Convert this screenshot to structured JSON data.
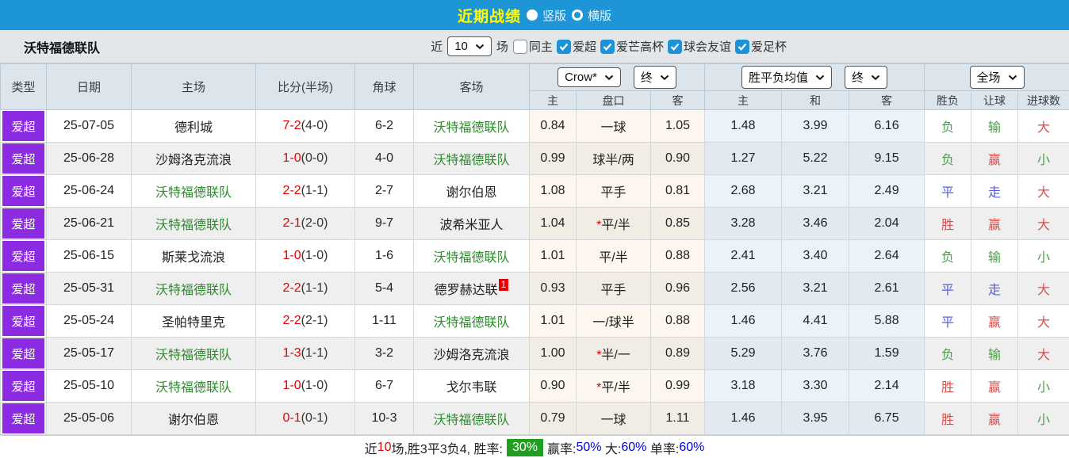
{
  "topbar": {
    "title": "近期战绩",
    "radios": [
      {
        "label": "竖版",
        "selected": true
      },
      {
        "label": "横版",
        "selected": false
      }
    ]
  },
  "filterbar": {
    "team": "沃特福德联队",
    "near": "近",
    "count": "10",
    "games": "场",
    "filters": [
      {
        "label": "同主",
        "checked": false
      },
      {
        "label": "爱超",
        "checked": true
      },
      {
        "label": "爱芒高杯",
        "checked": true
      },
      {
        "label": "球会友谊",
        "checked": true
      },
      {
        "label": "爱足杯",
        "checked": true
      }
    ]
  },
  "table": {
    "main_headers": [
      "类型",
      "日期",
      "主场",
      "比分(半场)",
      "角球",
      "客场"
    ],
    "selects": {
      "odds_company": "Crow*",
      "odds_state": "终",
      "avg_label": "胜平负均值",
      "avg_state": "终",
      "scope": "全场"
    },
    "sub_headers": [
      "主",
      "盘口",
      "客",
      "主",
      "和",
      "客",
      "胜负",
      "让球",
      "进球数"
    ],
    "rows": [
      {
        "type": "爱超",
        "date": "25-07-05",
        "home": "德利城",
        "home_class": "",
        "score": "7-2",
        "half": "(4-0)",
        "corner": "6-2",
        "away": "沃特福德联队",
        "away_class": "green",
        "away_badge": "",
        "odds_home": "0.84",
        "handicap_star": "",
        "handicap": "一球",
        "odds_away": "1.05",
        "avg_home": "1.48",
        "avg_draw": "3.99",
        "avg_away": "6.16",
        "res_wdl": "负",
        "res_wdl_class": "green",
        "res_ah": "输",
        "res_ah_class": "green",
        "res_ou": "大",
        "res_ou_class": "red"
      },
      {
        "type": "爱超",
        "date": "25-06-28",
        "home": "沙姆洛克流浪",
        "home_class": "",
        "score": "1-0",
        "half": "(0-0)",
        "corner": "4-0",
        "away": "沃特福德联队",
        "away_class": "green",
        "away_badge": "",
        "odds_home": "0.99",
        "handicap_star": "",
        "handicap": "球半/两",
        "odds_away": "0.90",
        "avg_home": "1.27",
        "avg_draw": "5.22",
        "avg_away": "9.15",
        "res_wdl": "负",
        "res_wdl_class": "green",
        "res_ah": "赢",
        "res_ah_class": "red",
        "res_ou": "小",
        "res_ou_class": "green"
      },
      {
        "type": "爱超",
        "date": "25-06-24",
        "home": "沃特福德联队",
        "home_class": "green",
        "score": "2-2",
        "half": "(1-1)",
        "corner": "2-7",
        "away": "谢尔伯恩",
        "away_class": "",
        "away_badge": "",
        "odds_home": "1.08",
        "handicap_star": "",
        "handicap": "平手",
        "odds_away": "0.81",
        "avg_home": "2.68",
        "avg_draw": "3.21",
        "avg_away": "2.49",
        "res_wdl": "平",
        "res_wdl_class": "blue",
        "res_ah": "走",
        "res_ah_class": "blue",
        "res_ou": "大",
        "res_ou_class": "red"
      },
      {
        "type": "爱超",
        "date": "25-06-21",
        "home": "沃特福德联队",
        "home_class": "green",
        "score": "2-1",
        "half": "(2-0)",
        "corner": "9-7",
        "away": "波希米亚人",
        "away_class": "",
        "away_badge": "",
        "odds_home": "1.04",
        "handicap_star": "*",
        "handicap": "平/半",
        "odds_away": "0.85",
        "avg_home": "3.28",
        "avg_draw": "3.46",
        "avg_away": "2.04",
        "res_wdl": "胜",
        "res_wdl_class": "red",
        "res_ah": "赢",
        "res_ah_class": "red",
        "res_ou": "大",
        "res_ou_class": "red"
      },
      {
        "type": "爱超",
        "date": "25-06-15",
        "home": "斯莱戈流浪",
        "home_class": "",
        "score": "1-0",
        "half": "(1-0)",
        "corner": "1-6",
        "away": "沃特福德联队",
        "away_class": "green",
        "away_badge": "",
        "odds_home": "1.01",
        "handicap_star": "",
        "handicap": "平/半",
        "odds_away": "0.88",
        "avg_home": "2.41",
        "avg_draw": "3.40",
        "avg_away": "2.64",
        "res_wdl": "负",
        "res_wdl_class": "green",
        "res_ah": "输",
        "res_ah_class": "green",
        "res_ou": "小",
        "res_ou_class": "green"
      },
      {
        "type": "爱超",
        "date": "25-05-31",
        "home": "沃特福德联队",
        "home_class": "green",
        "score": "2-2",
        "half": "(1-1)",
        "corner": "5-4",
        "away": "德罗赫达联",
        "away_class": "",
        "away_badge": "1",
        "odds_home": "0.93",
        "handicap_star": "",
        "handicap": "平手",
        "odds_away": "0.96",
        "avg_home": "2.56",
        "avg_draw": "3.21",
        "avg_away": "2.61",
        "res_wdl": "平",
        "res_wdl_class": "blue",
        "res_ah": "走",
        "res_ah_class": "blue",
        "res_ou": "大",
        "res_ou_class": "red"
      },
      {
        "type": "爱超",
        "date": "25-05-24",
        "home": "圣帕特里克",
        "home_class": "",
        "score": "2-2",
        "half": "(2-1)",
        "corner": "1-11",
        "away": "沃特福德联队",
        "away_class": "green",
        "away_badge": "",
        "odds_home": "1.01",
        "handicap_star": "",
        "handicap": "一/球半",
        "odds_away": "0.88",
        "avg_home": "1.46",
        "avg_draw": "4.41",
        "avg_away": "5.88",
        "res_wdl": "平",
        "res_wdl_class": "blue",
        "res_ah": "赢",
        "res_ah_class": "red",
        "res_ou": "大",
        "res_ou_class": "red"
      },
      {
        "type": "爱超",
        "date": "25-05-17",
        "home": "沃特福德联队",
        "home_class": "green",
        "score": "1-3",
        "half": "(1-1)",
        "corner": "3-2",
        "away": "沙姆洛克流浪",
        "away_class": "",
        "away_badge": "",
        "odds_home": "1.00",
        "handicap_star": "*",
        "handicap": "半/一",
        "odds_away": "0.89",
        "avg_home": "5.29",
        "avg_draw": "3.76",
        "avg_away": "1.59",
        "res_wdl": "负",
        "res_wdl_class": "green",
        "res_ah": "输",
        "res_ah_class": "green",
        "res_ou": "大",
        "res_ou_class": "red"
      },
      {
        "type": "爱超",
        "date": "25-05-10",
        "home": "沃特福德联队",
        "home_class": "green",
        "score": "1-0",
        "half": "(1-0)",
        "corner": "6-7",
        "away": "戈尔韦联",
        "away_class": "",
        "away_badge": "",
        "odds_home": "0.90",
        "handicap_star": "*",
        "handicap": "平/半",
        "odds_away": "0.99",
        "avg_home": "3.18",
        "avg_draw": "3.30",
        "avg_away": "2.14",
        "res_wdl": "胜",
        "res_wdl_class": "red",
        "res_ah": "赢",
        "res_ah_class": "red",
        "res_ou": "小",
        "res_ou_class": "green"
      },
      {
        "type": "爱超",
        "date": "25-05-06",
        "home": "谢尔伯恩",
        "home_class": "",
        "score": "0-1",
        "half": "(0-1)",
        "corner": "10-3",
        "away": "沃特福德联队",
        "away_class": "green",
        "away_badge": "",
        "odds_home": "0.79",
        "handicap_star": "",
        "handicap": "一球",
        "odds_away": "1.11",
        "avg_home": "1.46",
        "avg_draw": "3.95",
        "avg_away": "6.75",
        "res_wdl": "胜",
        "res_wdl_class": "red",
        "res_ah": "赢",
        "res_ah_class": "red",
        "res_ou": "小",
        "res_ou_class": "green"
      }
    ]
  },
  "footer": {
    "segments": [
      {
        "text": "近",
        "cls": ""
      },
      {
        "text": "10",
        "cls": "red"
      },
      {
        "text": "场,胜3平3负4, 胜率:",
        "cls": ""
      },
      {
        "text": "30%",
        "cls": "badge"
      },
      {
        "text": "赢率:",
        "cls": ""
      },
      {
        "text": "50%",
        "cls": "blue"
      },
      {
        "text": " 大:",
        "cls": ""
      },
      {
        "text": "60%",
        "cls": "blue"
      },
      {
        "text": " 单率:",
        "cls": ""
      },
      {
        "text": "60%",
        "cls": "blue"
      }
    ]
  },
  "colors": {
    "topbar_blue": "#1d95d6",
    "title_yellow": "#ffff00",
    "league_purple": "#8b2be2",
    "team_green": "#2e8b2e",
    "score_red": "#e60000",
    "result_red": "#d94f4f",
    "result_green": "#4d9d4d",
    "result_blue": "#5a5fd8",
    "rate_blue": "#0000e0",
    "win_rate_badge_green": "#1f9e1f",
    "checkbox_blue": "#1c93d9"
  }
}
